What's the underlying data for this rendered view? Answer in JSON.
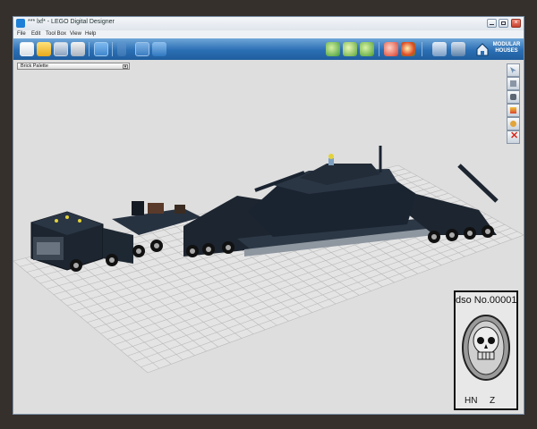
{
  "app": {
    "title": "*** lxf* - LEGO Digital Designer"
  },
  "menu": [
    {
      "label": "File"
    },
    {
      "label": "Edit"
    },
    {
      "label": "Tool Box"
    },
    {
      "label": "View"
    },
    {
      "label": "Help"
    }
  ],
  "toolbar": {
    "modular_houses_line1": "MODULAR",
    "modular_houses_line2": "HOUSES",
    "button_icons": [
      "new-file-icon",
      "open-folder-icon",
      "save-icon",
      "print-icon",
      "camera-icon",
      "arrow-icon",
      "zoom-icon",
      "view-icon",
      "build-mode-icon",
      "rotate-icon",
      "grid-icon",
      "undo-icon",
      "redo-icon",
      "home-icon",
      "mixer-icon",
      "group-icon"
    ]
  },
  "palette": {
    "label": "Brick Palette"
  },
  "side_tools": [
    "select-cursor-icon",
    "clone-icon",
    "hinge-icon",
    "paint-icon",
    "hide-icon",
    "delete-icon"
  ],
  "watermark": {
    "top_text": "dso No.00001",
    "bottom_left": "HN",
    "bottom_right": "Z"
  },
  "colors": {
    "toolbar": "#2b6fb4",
    "viewport": "#dedede",
    "model": "#1c2530",
    "grid": "#bcbcbc",
    "delete": "#d8251a"
  }
}
